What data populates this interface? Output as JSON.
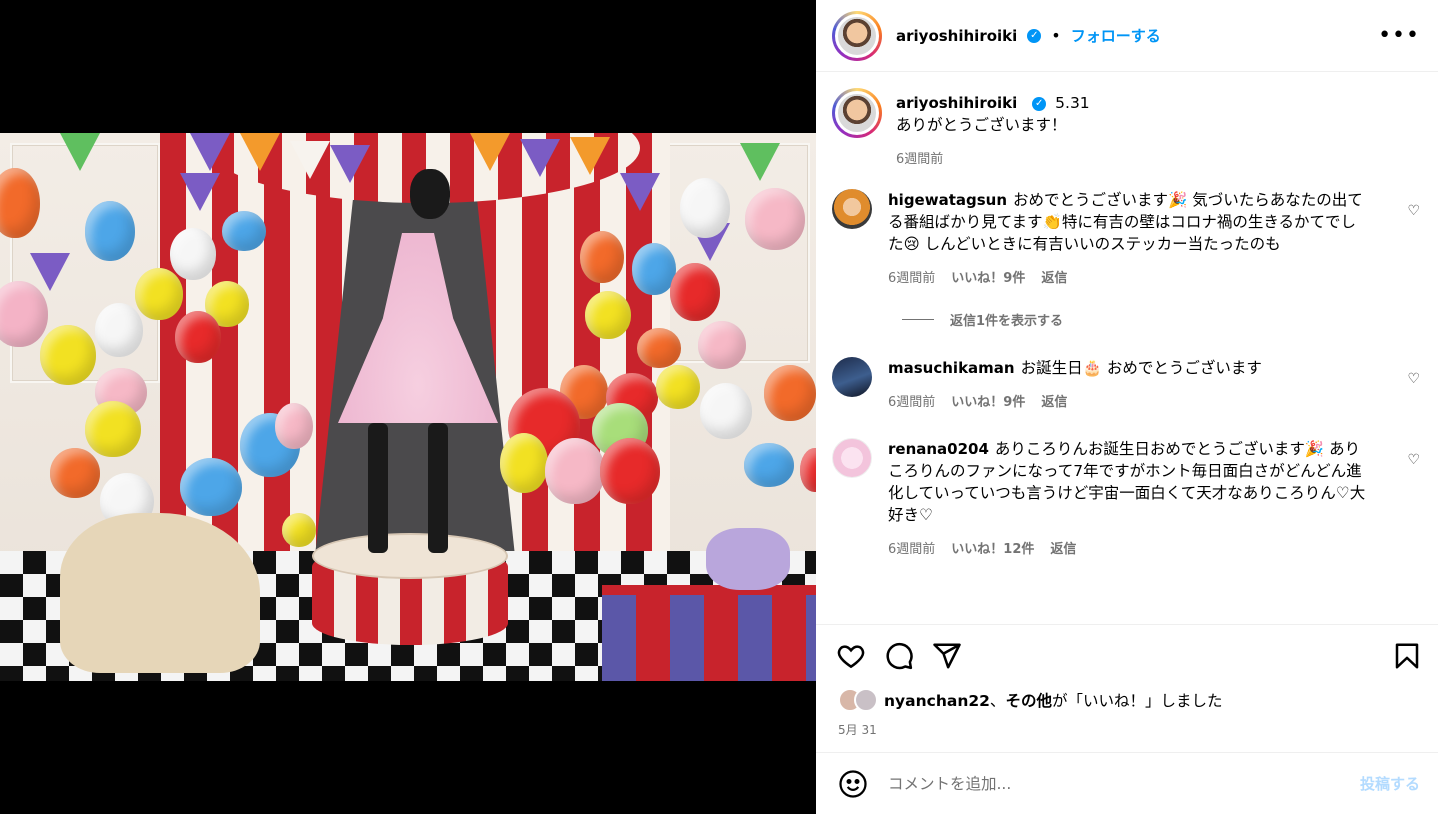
{
  "post": {
    "author": "ariyoshihiroiki",
    "follow_label": "フォローする",
    "dot": "•",
    "more_icon": "more-options-icon"
  },
  "caption": {
    "username": "ariyoshihiroiki",
    "date_tag": "5.31",
    "text": "ありがとうございます！",
    "age": "6週間前"
  },
  "comments": [
    {
      "username": "higewatagsun",
      "text": "おめでとうございます🎉 気づいたらあなたの出てる番組ばかり見てます👏特に有吉の壁はコロナ禍の生きるかてでした😢 しんどいときに有吉いいのステッカー当たったのも",
      "age": "6週間前",
      "likes": "いいね！9件",
      "reply": "返信",
      "view_replies": "返信1件を表示する"
    },
    {
      "username": "masuchikaman",
      "text": "お誕生日🎂 おめでとうございます",
      "age": "6週間前",
      "likes": "いいね！9件",
      "reply": "返信"
    },
    {
      "username": "renana0204",
      "text": "ありころりんお誕生日おめでとうございます🎉 ありころりんのファンになって7年ですがホント毎日面白さがどんどん進化していっていつも言うけど宇宙一面白くて天才なありころりん♡大好き♡",
      "age": "6週間前",
      "likes": "いいね！12件",
      "reply": "返信"
    }
  ],
  "liked_by": {
    "user": "nyanchan22",
    "separator": "、",
    "others": "その他",
    "suffix": "が「いいね！」しました"
  },
  "post_date": "5月 31",
  "composer": {
    "placeholder": "コメントを追加...",
    "post_label": "投稿する"
  },
  "colors": {
    "accent": "#0095f6",
    "muted": "#737373"
  }
}
